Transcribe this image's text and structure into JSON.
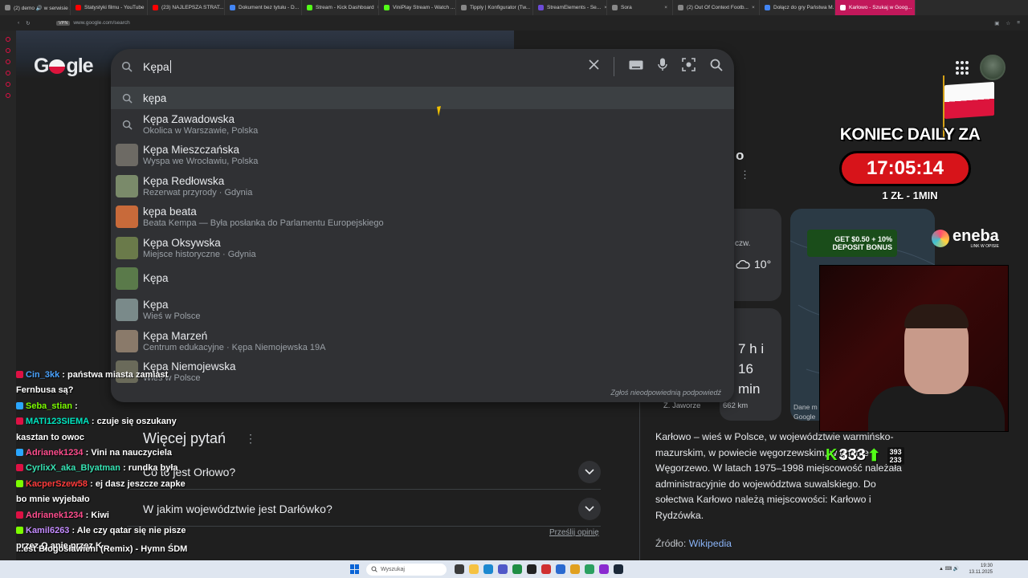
{
  "browser": {
    "tabs": [
      {
        "label": "(2) demo 🔊 w serwisie X",
        "color": "#888"
      },
      {
        "label": "Statystyki filmu - YouTube",
        "color": "#ff0000"
      },
      {
        "label": "(23) NAJLEPSZA STRAT...",
        "color": "#ff0000"
      },
      {
        "label": "Dokument bez tytułu - D...",
        "color": "#4285f4"
      },
      {
        "label": "Stream - Kick Dashboard",
        "color": "#53fc18"
      },
      {
        "label": "ViniPlay Stream - Watch ...",
        "color": "#53fc18"
      },
      {
        "label": "Tipply | Konfigurator (Tw...",
        "color": "#888"
      },
      {
        "label": "StreamElements - Se...",
        "color": "#6c4bd8"
      },
      {
        "label": "Sora",
        "color": "#888"
      },
      {
        "label": "(2) Out Of Context Footb...",
        "color": "#888"
      },
      {
        "label": "Dołącz do gry Państwa M...",
        "color": "#4285f4"
      },
      {
        "label": "Karłowo - Szukaj w Goog...",
        "color": "#fff"
      }
    ],
    "url": "www.google.com/search",
    "vpn_label": "VPN"
  },
  "search": {
    "query": "Kępa",
    "top_suggestion": "kępa",
    "suggestions": [
      {
        "title": "Kępa Zawadowska",
        "subtitle": "Okolica w Warszawie, Polska",
        "kind": "search",
        "thumb": ""
      },
      {
        "title": "Kępa Mieszczańska",
        "subtitle": "Wyspa we Wrocławiu, Polska",
        "kind": "thumb",
        "thumb": "#6d6a64"
      },
      {
        "title": "Kępa Redłowska",
        "subtitle": "Rezerwat przyrody · Gdynia",
        "kind": "thumb",
        "thumb": "#7a8a6a"
      },
      {
        "title": "kępa beata",
        "subtitle": "Beata Kempa — Była posłanka do Parlamentu Europejskiego",
        "kind": "thumb",
        "thumb": "#c86a3a"
      },
      {
        "title": "Kępa Oksywska",
        "subtitle": "Miejsce historyczne · Gdynia",
        "kind": "thumb",
        "thumb": "#6a7a4a"
      },
      {
        "title": "Kępa",
        "subtitle": "",
        "kind": "thumb",
        "thumb": "#5a7a4a"
      },
      {
        "title": "Kępa",
        "subtitle": "Wieś w Polsce",
        "kind": "thumb",
        "thumb": "#7a8a8a"
      },
      {
        "title": "Kępa Marzeń",
        "subtitle": "Centrum edukacyjne · Kępa Niemojewska 19A",
        "kind": "thumb",
        "thumb": "#8a7a6a"
      },
      {
        "title": "Kępa Niemojewska",
        "subtitle": "Wieś w Polsce",
        "kind": "thumb",
        "thumb": "#6a6a5a"
      }
    ],
    "report_text": "Zgłoś nieodpowiednią podpowiedź"
  },
  "results": {
    "more_questions": "Więcej pytań",
    "questions": [
      "Co to jest Orłowo?",
      "W jakim województwie jest Darłówko?"
    ],
    "feedback": "Prześlij opinię"
  },
  "knowledge_panel": {
    "title_fragment": "o",
    "weather_day": "czw.",
    "weather_temp": "10°",
    "travel_hours": "7 h i",
    "travel_minutes": "16",
    "travel_unit": "min",
    "origin": "Z. Jaworze",
    "distance": "662 km",
    "map_credit_1": "Dane m",
    "map_credit_2": "Google",
    "description": "Karłowo – wieś w Polsce, w województwie warmińsko-mazurskim, w powiecie węgorzewskim, w gminie Węgorzewo. W latach 1975–1998 miejscowość należała administracyjnie do województwa suwalskiego. Do sołectwa Karłowo należą miejscowości: Karłowo i Rydzówka.",
    "source_label": "Źródło:",
    "source_link": "Wikipedia"
  },
  "overlay": {
    "koniec": "KONIEC DAILY ZA",
    "timer": "17:05:14",
    "rate": "1 ZŁ - 1MIN",
    "promo": "GET $0.50 + 10% DEPOSIT BONUS",
    "eneba": "eneba",
    "eneba_sub": "LINK W OPISIE",
    "kick_count": "333",
    "kick_stat_1": "393",
    "kick_stat_2": "233"
  },
  "chat": [
    {
      "user": "Cin_3kk",
      "color": "#4aa3ff",
      "msg": ": państwa miasta zamiast"
    },
    {
      "user": "",
      "color": "#fff",
      "msg": "Fernbusa są?"
    },
    {
      "user": "Seba_stian",
      "color": "#7cfc00",
      "msg": ":"
    },
    {
      "user": "MATI123SIEMA",
      "color": "#00e5c0",
      "msg": ": czuje się oszukany"
    },
    {
      "user": "",
      "color": "#fff",
      "msg": "kasztan to owoc"
    },
    {
      "user": "Adrianek1234",
      "color": "#ff4d8d",
      "msg": ": Vini na nauczyciela"
    },
    {
      "user": "CyrlixX_aka_Blyatman",
      "color": "#36e3b3",
      "msg": ": rundka była"
    },
    {
      "user": "KacperSzew58",
      "color": "#ff3b3b",
      "msg": ": ej dasz jeszcze zapke"
    },
    {
      "user": "",
      "color": "#fff",
      "msg": "bo mnie wyjebało"
    },
    {
      "user": "Adrianek1234",
      "color": "#ff4d8d",
      "msg": ": Kiwi"
    },
    {
      "user": "Kamil6263",
      "color": "#c48cff",
      "msg": ": Ale czy qatar się nie pisze"
    },
    {
      "user": "",
      "color": "#fff",
      "msg": "przez Q anie przez K"
    }
  ],
  "now_playing": "...est Błogosławieni (Remix) - Hymn ŚDM",
  "taskbar": {
    "search_placeholder": "Wyszukaj",
    "time": "19:30",
    "date": "13.11.2025"
  }
}
